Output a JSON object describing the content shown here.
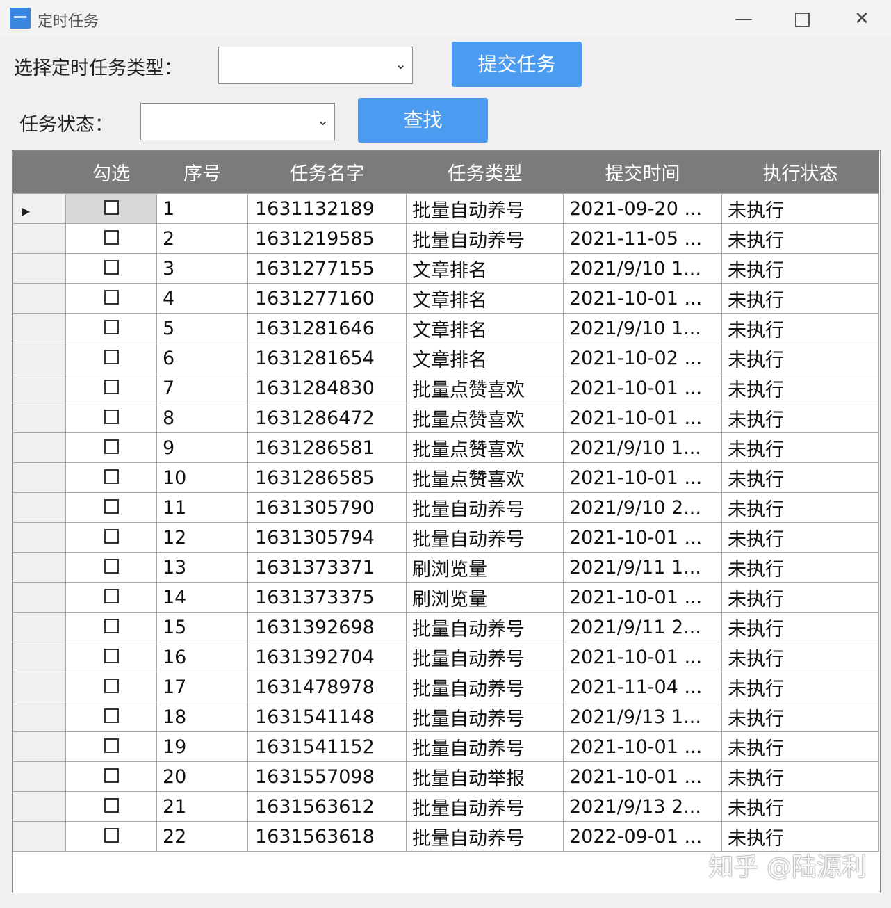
{
  "window": {
    "title": "定时任务"
  },
  "form": {
    "type_label": "选择定时任务类型：",
    "type_value": "",
    "submit_button": "提交任务",
    "status_label": "任务状态：",
    "status_value": "",
    "search_button": "查找"
  },
  "table": {
    "headers": [
      "勾选",
      "序号",
      "任务名字",
      "任务类型",
      "提交时间",
      "执行状态"
    ],
    "rows": [
      {
        "seq": "1",
        "name": "1631132189",
        "type": "批量自动养号",
        "time": "2021-09-20 ...",
        "status": "未执行"
      },
      {
        "seq": "2",
        "name": "1631219585",
        "type": "批量自动养号",
        "time": "2021-11-05 ...",
        "status": "未执行"
      },
      {
        "seq": "3",
        "name": "1631277155",
        "type": "文章排名",
        "time": "2021/9/10 1...",
        "status": "未执行"
      },
      {
        "seq": "4",
        "name": "1631277160",
        "type": "文章排名",
        "time": "2021-10-01 ...",
        "status": "未执行"
      },
      {
        "seq": "5",
        "name": "1631281646",
        "type": "文章排名",
        "time": "2021/9/10 1...",
        "status": "未执行"
      },
      {
        "seq": "6",
        "name": "1631281654",
        "type": "文章排名",
        "time": "2021-10-02 ...",
        "status": "未执行"
      },
      {
        "seq": "7",
        "name": "1631284830",
        "type": "批量点赞喜欢",
        "time": "2021-10-01 ...",
        "status": "未执行"
      },
      {
        "seq": "8",
        "name": "1631286472",
        "type": "批量点赞喜欢",
        "time": "2021-10-01 ...",
        "status": "未执行"
      },
      {
        "seq": "9",
        "name": "1631286581",
        "type": "批量点赞喜欢",
        "time": "2021/9/10 1...",
        "status": "未执行"
      },
      {
        "seq": "10",
        "name": "1631286585",
        "type": "批量点赞喜欢",
        "time": "2021-10-01 ...",
        "status": "未执行"
      },
      {
        "seq": "11",
        "name": "1631305790",
        "type": "批量自动养号",
        "time": "2021/9/10 2...",
        "status": "未执行"
      },
      {
        "seq": "12",
        "name": "1631305794",
        "type": "批量自动养号",
        "time": "2021-10-01 ...",
        "status": "未执行"
      },
      {
        "seq": "13",
        "name": "1631373371",
        "type": "刷浏览量",
        "time": "2021/9/11 1...",
        "status": "未执行"
      },
      {
        "seq": "14",
        "name": "1631373375",
        "type": "刷浏览量",
        "time": "2021-10-01 ...",
        "status": "未执行"
      },
      {
        "seq": "15",
        "name": "1631392698",
        "type": "批量自动养号",
        "time": "2021/9/11 2...",
        "status": "未执行"
      },
      {
        "seq": "16",
        "name": "1631392704",
        "type": "批量自动养号",
        "time": "2021-10-01 ...",
        "status": "未执行"
      },
      {
        "seq": "17",
        "name": "1631478978",
        "type": "批量自动养号",
        "time": "2021-11-04 ...",
        "status": "未执行"
      },
      {
        "seq": "18",
        "name": "1631541148",
        "type": "批量自动养号",
        "time": "2021/9/13 1...",
        "status": "未执行"
      },
      {
        "seq": "19",
        "name": "1631541152",
        "type": "批量自动养号",
        "time": "2021-10-01 ...",
        "status": "未执行"
      },
      {
        "seq": "20",
        "name": "1631557098",
        "type": "批量自动举报",
        "time": "2021-10-01 ...",
        "status": "未执行"
      },
      {
        "seq": "21",
        "name": "1631563612",
        "type": "批量自动养号",
        "time": "2021/9/13 2...",
        "status": "未执行"
      },
      {
        "seq": "22",
        "name": "1631563618",
        "type": "批量自动养号",
        "time": "2022-09-01 ...",
        "status": "未执行"
      }
    ]
  },
  "watermark": "知乎 @陆源利",
  "colors": {
    "button": "#4b9bf0",
    "header": "#7b7b7b"
  }
}
